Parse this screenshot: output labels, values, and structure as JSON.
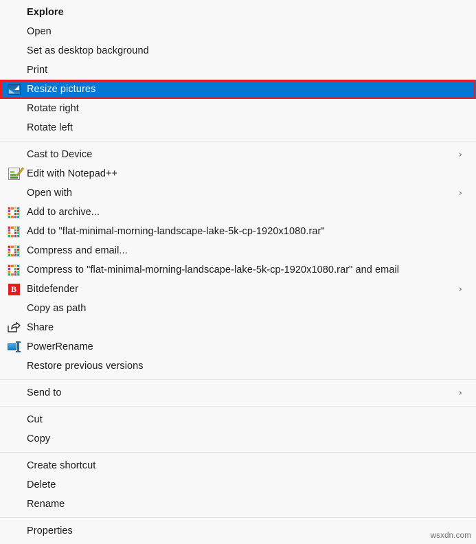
{
  "menu": {
    "background_color": "#f8f8f8",
    "highlight_color": "#0078d4",
    "highlight_outline_color": "#ec1c24",
    "groups": [
      {
        "items": [
          {
            "label": "Explore",
            "icon": "none",
            "bold": true,
            "submenu": false,
            "highlighted": false
          },
          {
            "label": "Open",
            "icon": "none",
            "bold": false,
            "submenu": false,
            "highlighted": false
          },
          {
            "label": "Set as desktop background",
            "icon": "none",
            "bold": false,
            "submenu": false,
            "highlighted": false
          },
          {
            "label": "Print",
            "icon": "none",
            "bold": false,
            "submenu": false,
            "highlighted": false
          },
          {
            "label": "Resize pictures",
            "icon": "resize-pictures-icon",
            "bold": false,
            "submenu": false,
            "highlighted": true
          },
          {
            "label": "Rotate right",
            "icon": "none",
            "bold": false,
            "submenu": false,
            "highlighted": false
          },
          {
            "label": "Rotate left",
            "icon": "none",
            "bold": false,
            "submenu": false,
            "highlighted": false
          }
        ]
      },
      {
        "items": [
          {
            "label": "Cast to Device",
            "icon": "none",
            "bold": false,
            "submenu": true,
            "highlighted": false
          },
          {
            "label": "Edit with Notepad++",
            "icon": "notepad-plus-plus-icon",
            "bold": false,
            "submenu": false,
            "highlighted": false
          },
          {
            "label": "Open with",
            "icon": "none",
            "bold": false,
            "submenu": true,
            "highlighted": false
          },
          {
            "label": "Add to archive...",
            "icon": "winrar-icon",
            "bold": false,
            "submenu": false,
            "highlighted": false
          },
          {
            "label": "Add to \"flat-minimal-morning-landscape-lake-5k-cp-1920x1080.rar\"",
            "icon": "winrar-icon",
            "bold": false,
            "submenu": false,
            "highlighted": false
          },
          {
            "label": "Compress and email...",
            "icon": "winrar-icon",
            "bold": false,
            "submenu": false,
            "highlighted": false
          },
          {
            "label": "Compress to \"flat-minimal-morning-landscape-lake-5k-cp-1920x1080.rar\" and email",
            "icon": "winrar-icon",
            "bold": false,
            "submenu": false,
            "highlighted": false
          },
          {
            "label": "Bitdefender",
            "icon": "bitdefender-icon",
            "bold": false,
            "submenu": true,
            "highlighted": false
          },
          {
            "label": "Copy as path",
            "icon": "none",
            "bold": false,
            "submenu": false,
            "highlighted": false
          },
          {
            "label": "Share",
            "icon": "share-icon",
            "bold": false,
            "submenu": false,
            "highlighted": false
          },
          {
            "label": "PowerRename",
            "icon": "powerrename-icon",
            "bold": false,
            "submenu": false,
            "highlighted": false
          },
          {
            "label": "Restore previous versions",
            "icon": "none",
            "bold": false,
            "submenu": false,
            "highlighted": false
          }
        ]
      },
      {
        "items": [
          {
            "label": "Send to",
            "icon": "none",
            "bold": false,
            "submenu": true,
            "highlighted": false
          }
        ]
      },
      {
        "items": [
          {
            "label": "Cut",
            "icon": "none",
            "bold": false,
            "submenu": false,
            "highlighted": false
          },
          {
            "label": "Copy",
            "icon": "none",
            "bold": false,
            "submenu": false,
            "highlighted": false
          }
        ]
      },
      {
        "items": [
          {
            "label": "Create shortcut",
            "icon": "none",
            "bold": false,
            "submenu": false,
            "highlighted": false
          },
          {
            "label": "Delete",
            "icon": "none",
            "bold": false,
            "submenu": false,
            "highlighted": false
          },
          {
            "label": "Rename",
            "icon": "none",
            "bold": false,
            "submenu": false,
            "highlighted": false
          }
        ]
      },
      {
        "items": [
          {
            "label": "Properties",
            "icon": "none",
            "bold": false,
            "submenu": false,
            "highlighted": false
          }
        ]
      }
    ]
  },
  "watermark": {
    "text": "wsxdn.com"
  },
  "glyphs": {
    "chevron_right": "›"
  }
}
